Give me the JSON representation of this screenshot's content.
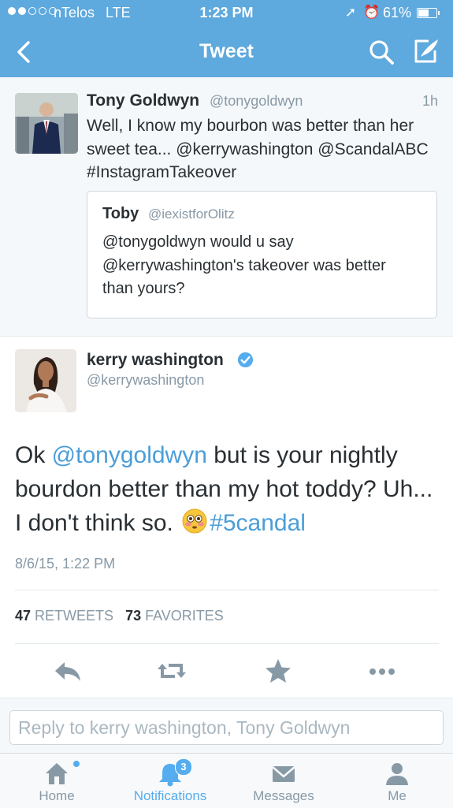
{
  "status_bar": {
    "carrier": "nTelos",
    "network": "LTE",
    "time": "1:23 PM",
    "battery": "61%",
    "battery_level": 0.61
  },
  "nav": {
    "title": "Tweet",
    "back_icon": "chevron-left-icon",
    "search_icon": "search-icon",
    "compose_icon": "compose-icon"
  },
  "parent_tweet": {
    "name": "Tony Goldwyn",
    "handle": "@tonygoldwyn",
    "time": "1h",
    "text": "Well, I know my bourbon was better than her sweet tea... @kerrywashington @ScandalABC #InstagramTakeover",
    "quoted": {
      "name": "Toby",
      "handle": "@iexistforOlitz",
      "text": "@tonygoldwyn would u say @kerrywashington's takeover was better than yours?"
    }
  },
  "main_tweet": {
    "name": "kerry washington",
    "handle": "@kerrywashington",
    "text_part1": "Ok ",
    "mention": "@tonygoldwyn",
    "text_part2": " but is your nightly bourdon better than my hot toddy? Uh... I don't think so. ",
    "emoji": "flushed-face-emoji",
    "hashtag": "#5candal",
    "date": "8/6/15, 1:22 PM",
    "retweets_count": "47",
    "retweets_label": "RETWEETS",
    "favorites_count": "73",
    "favorites_label": "FAVORITES"
  },
  "actions": [
    "reply-icon",
    "retweet-icon",
    "favorite-icon",
    "more-icon"
  ],
  "reply": {
    "placeholder": "Reply to kerry washington, Tony Goldwyn"
  },
  "tabs": [
    {
      "label": "Home",
      "icon": "home-icon"
    },
    {
      "label": "Notifications",
      "icon": "bell-icon",
      "badge": "3"
    },
    {
      "label": "Messages",
      "icon": "envelope-icon"
    },
    {
      "label": "Me",
      "icon": "person-icon"
    }
  ],
  "colors": {
    "header": "#5ea9dd",
    "link": "#4a9ed9",
    "accent": "#55acee",
    "icon_gray": "#8899a6"
  }
}
